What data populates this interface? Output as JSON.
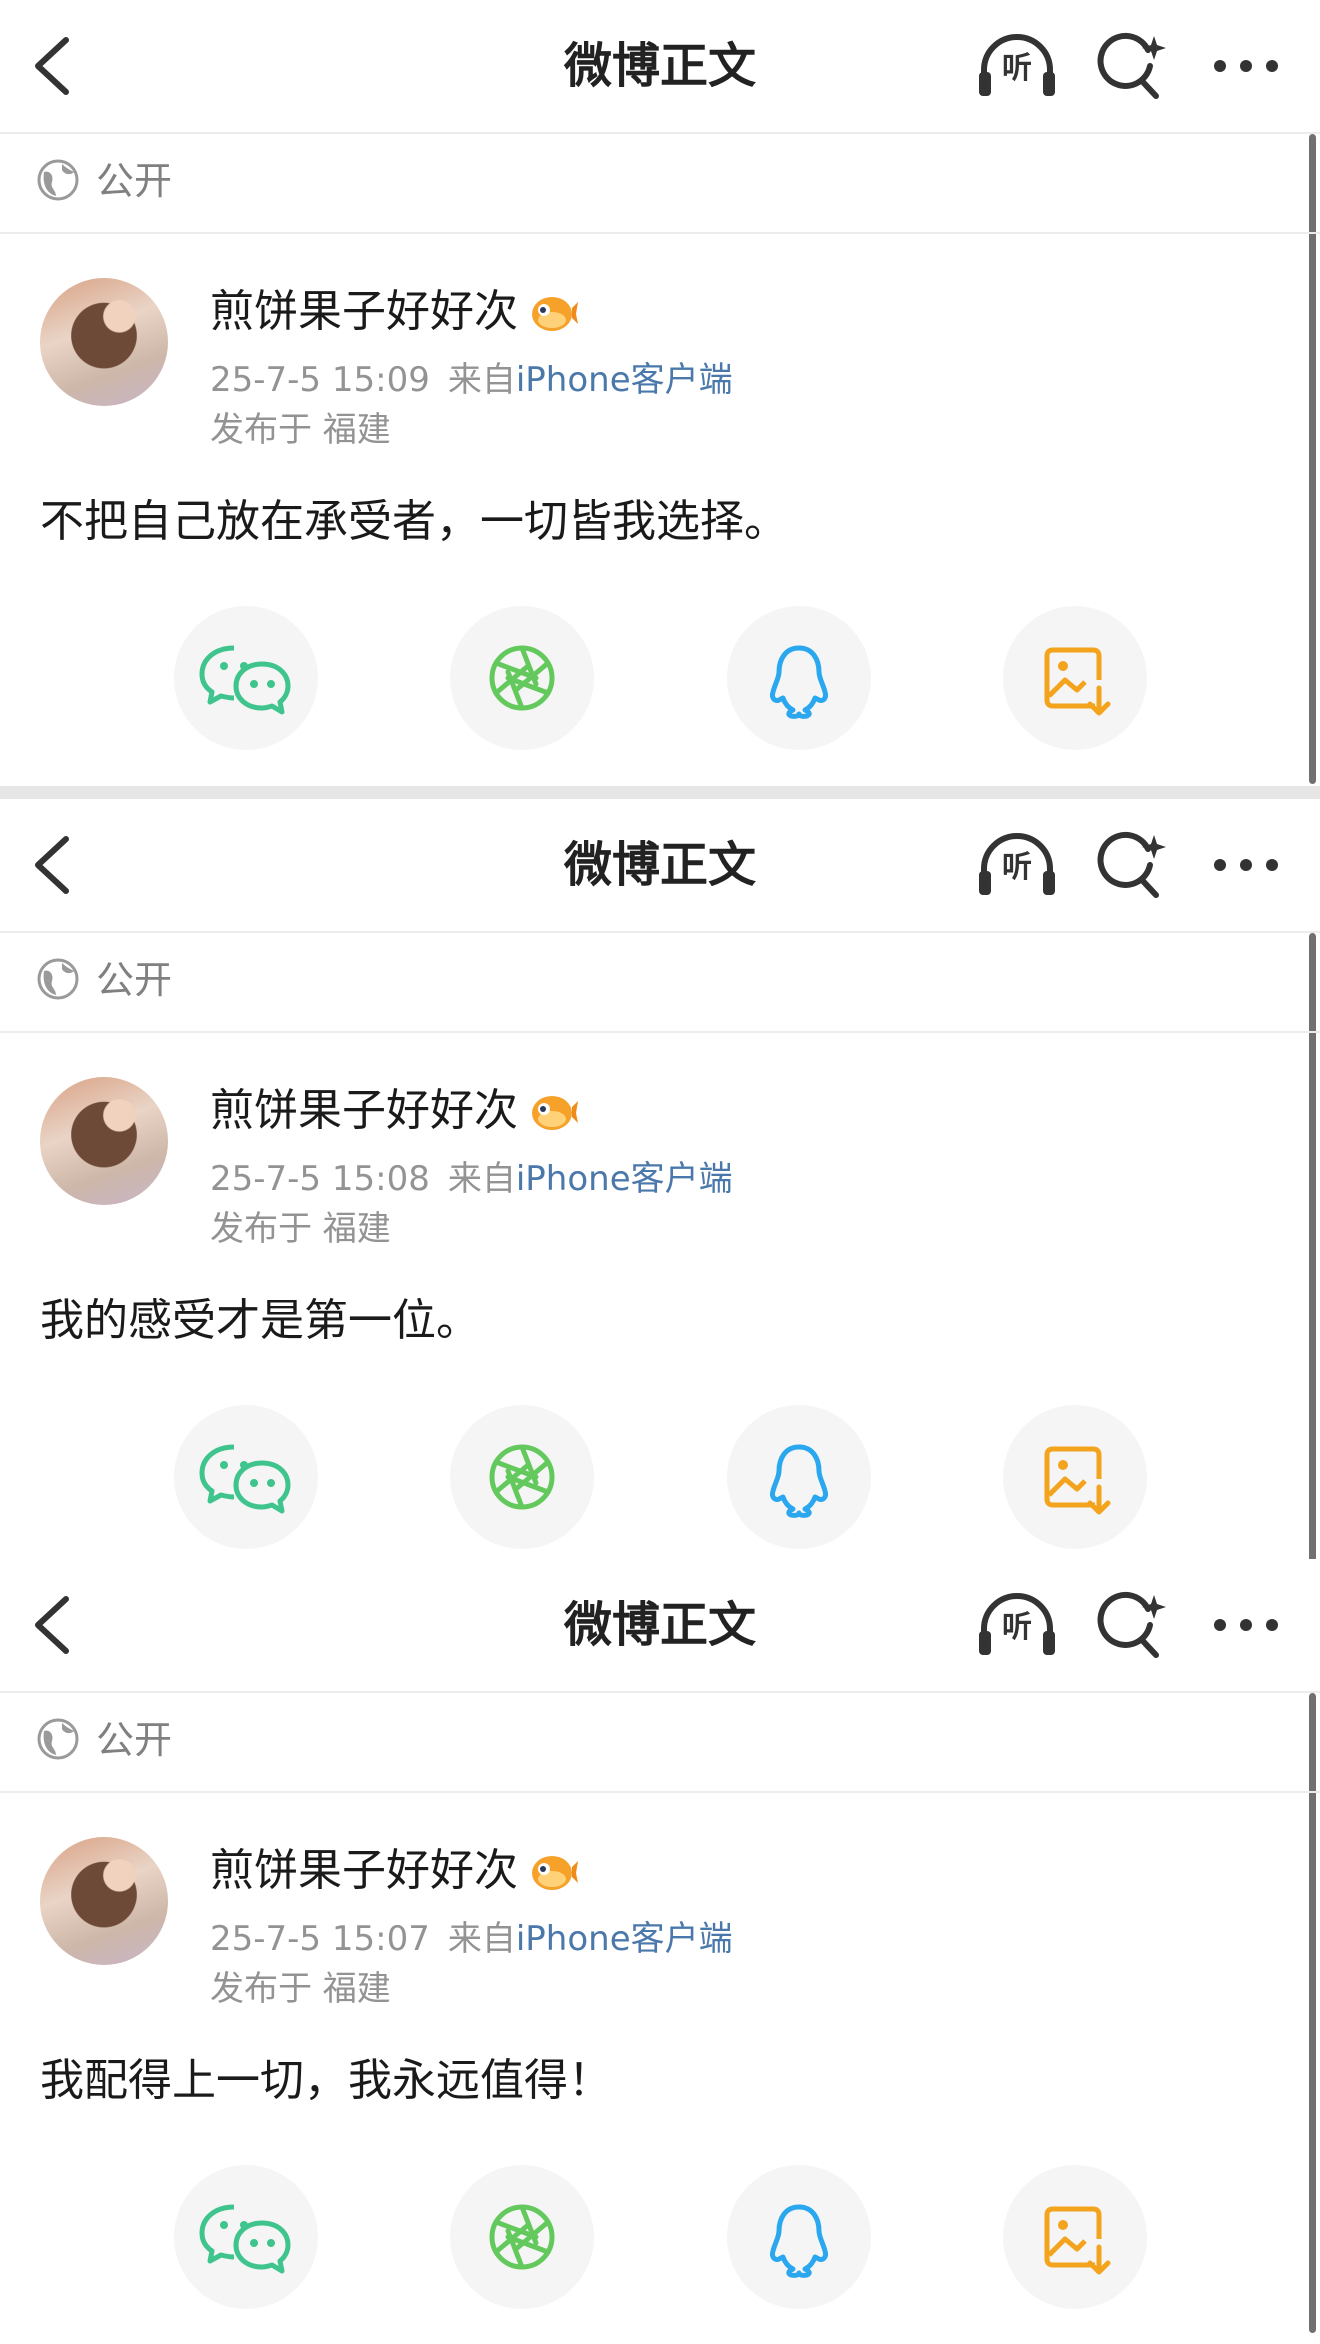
{
  "colors": {
    "link_blue": "#4b78ab",
    "wechat_green": "#3ec48c",
    "moments_green": "#64c95c",
    "qq_blue": "#2aa7ee",
    "save_orange": "#f4a31d",
    "meta_gray": "#939393"
  },
  "icons": {
    "back": "chevron-left-icon",
    "listen": "headphones-icon",
    "search": "search-sparkle-icon",
    "more": "more-dots-icon",
    "visibility": "globe-icon",
    "badge": "pufferfish-badge-icon",
    "share": [
      "wechat-icon",
      "moments-icon",
      "qq-icon",
      "save-image-icon"
    ]
  },
  "posts": [
    {
      "nav": {
        "title": "微博正文",
        "listen_label": "听"
      },
      "visibility": "公开",
      "author": "煎饼果子好好次",
      "time": "25-7-5 15:09",
      "source_prefix": "来自",
      "source": "iPhone客户端",
      "location": "发布于 福建",
      "text": "不把自己放在承受者，一切皆我选择。"
    },
    {
      "nav": {
        "title": "微博正文",
        "listen_label": "听"
      },
      "visibility": "公开",
      "author": "煎饼果子好好次",
      "time": "25-7-5 15:08",
      "source_prefix": "来自",
      "source": "iPhone客户端",
      "location": "发布于 福建",
      "text": "我的感受才是第一位。"
    },
    {
      "nav": {
        "title": "微博正文",
        "listen_label": "听"
      },
      "visibility": "公开",
      "author": "煎饼果子好好次",
      "time": "25-7-5 15:07",
      "source_prefix": "来自",
      "source": "iPhone客户端",
      "location": "发布于 福建",
      "text": "我配得上一切，我永远值得！"
    }
  ]
}
